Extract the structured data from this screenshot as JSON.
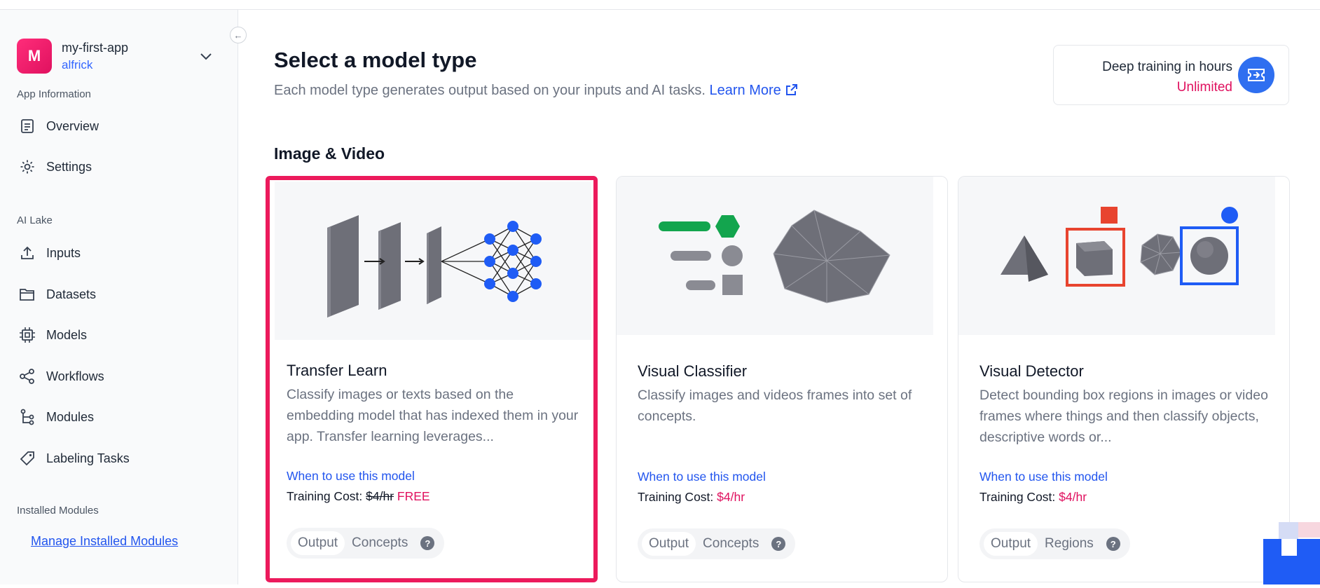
{
  "sidebar": {
    "app_name": "my-first-app",
    "app_user": "alfrick",
    "avatar_letter": "M",
    "sections": {
      "app_info": "App Information",
      "ai_lake": "AI Lake",
      "installed_modules": "Installed Modules"
    },
    "items": [
      {
        "label": "Overview",
        "icon": "document-icon"
      },
      {
        "label": "Settings",
        "icon": "gear-icon"
      },
      {
        "label": "Inputs",
        "icon": "upload-icon"
      },
      {
        "label": "Datasets",
        "icon": "folder-icon"
      },
      {
        "label": "Models",
        "icon": "chip-icon"
      },
      {
        "label": "Workflows",
        "icon": "share-icon"
      },
      {
        "label": "Modules",
        "icon": "tree-icon"
      },
      {
        "label": "Labeling Tasks",
        "icon": "tag-icon"
      }
    ],
    "manage_link": "Manage Installed Modules"
  },
  "main": {
    "title": "Select a model type",
    "subtitle": "Each model type generates output based on your inputs and AI tasks.",
    "learn_more": "Learn More",
    "hours": {
      "label": "Deep training in hours",
      "value": "Unlimited"
    },
    "section": "Image & Video",
    "cards": [
      {
        "title": "Transfer Learn",
        "description": "Classify images or texts based on the embedding model that has indexed them in your app. Transfer learning leverages...",
        "when": "When to use this model",
        "cost_label": "Training Cost:",
        "cost_old": "$4/hr",
        "cost_value": "FREE",
        "tags": [
          "Output",
          "Concepts"
        ],
        "selected": true
      },
      {
        "title": "Visual Classifier",
        "description": "Classify images and videos frames into set of concepts.",
        "when": "When to use this model",
        "cost_label": "Training Cost:",
        "cost_value": "$4/hr",
        "tags": [
          "Output",
          "Concepts"
        ]
      },
      {
        "title": "Visual Detector",
        "description": "Detect bounding box regions in images or video frames where things and then classify objects, descriptive words or...",
        "when": "When to use this model",
        "cost_label": "Training Cost:",
        "cost_value": "$4/hr",
        "tags": [
          "Output",
          "Regions"
        ]
      }
    ]
  },
  "colors": {
    "accent_pink": "#e0115f",
    "link_blue": "#2255ee",
    "selected_border": "#ec1a5c"
  }
}
